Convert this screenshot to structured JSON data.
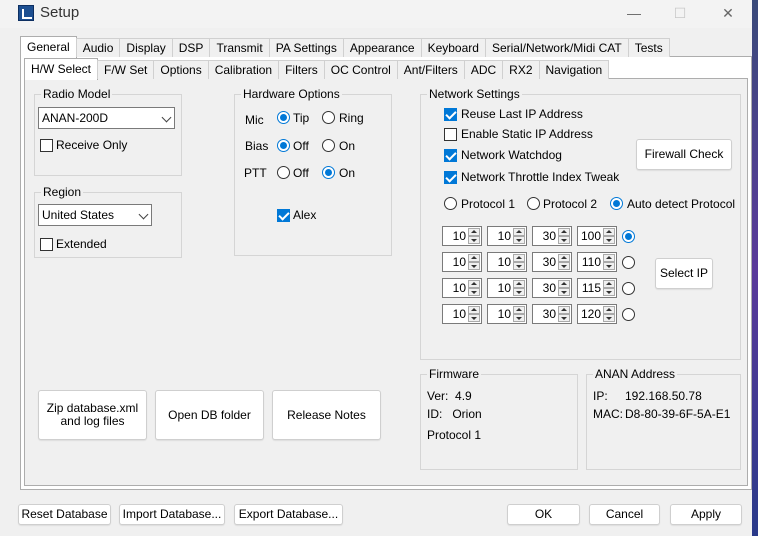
{
  "window": {
    "title": "Setup",
    "minimize": "—",
    "maximize": "☐",
    "close": "✕"
  },
  "tabs_top": [
    "General",
    "Audio",
    "Display",
    "DSP",
    "Transmit",
    "PA Settings",
    "Appearance",
    "Keyboard",
    "Serial/Network/Midi CAT",
    "Tests"
  ],
  "tabs_sub": [
    "H/W Select",
    "F/W Set",
    "Options",
    "Calibration",
    "Filters",
    "OC Control",
    "Ant/Filters",
    "ADC",
    "RX2",
    "Navigation"
  ],
  "radio_model": {
    "label": "Radio Model",
    "value": "ANAN-200D",
    "receive_only": "Receive Only"
  },
  "region": {
    "label": "Region",
    "value": "United States",
    "extended": "Extended"
  },
  "hardware": {
    "label": "Hardware Options",
    "mic": "Mic",
    "tip": "Tip",
    "ring": "Ring",
    "bias": "Bias",
    "off": "Off",
    "on": "On",
    "ptt": "PTT",
    "alex": "Alex"
  },
  "network": {
    "label": "Network Settings",
    "reuse_ip": "Reuse Last IP Address",
    "static_ip": "Enable Static IP Address",
    "watchdog": "Network Watchdog",
    "throttle": "Network Throttle Index Tweak",
    "firewall": "Firewall Check",
    "protocol1": "Protocol 1",
    "protocol2": "Protocol 2",
    "auto": "Auto detect Protocol",
    "select_ip": "Select IP",
    "ips": [
      [
        "10",
        "10",
        "30",
        "100"
      ],
      [
        "10",
        "10",
        "30",
        "110"
      ],
      [
        "10",
        "10",
        "30",
        "115"
      ],
      [
        "10",
        "10",
        "30",
        "120"
      ]
    ]
  },
  "firmware": {
    "label": "Firmware",
    "ver": "Ver:  4.9",
    "id": "ID:   Orion",
    "protocol": "Protocol 1"
  },
  "anan": {
    "label": "ANAN Address",
    "ip_label": "IP:",
    "ip": "192.168.50.78",
    "mac_label": "MAC:",
    "mac": "D8-80-39-6F-5A-E1"
  },
  "actions": {
    "zip1": "Zip database.xml",
    "zip2": "and log files",
    "open_db": "Open DB folder",
    "release": "Release Notes"
  },
  "bottom": {
    "reset": "Reset Database",
    "import": "Import Database...",
    "export": "Export Database...",
    "ok": "OK",
    "cancel": "Cancel",
    "apply": "Apply"
  },
  "colors": {
    "accent": "#0078d7"
  }
}
